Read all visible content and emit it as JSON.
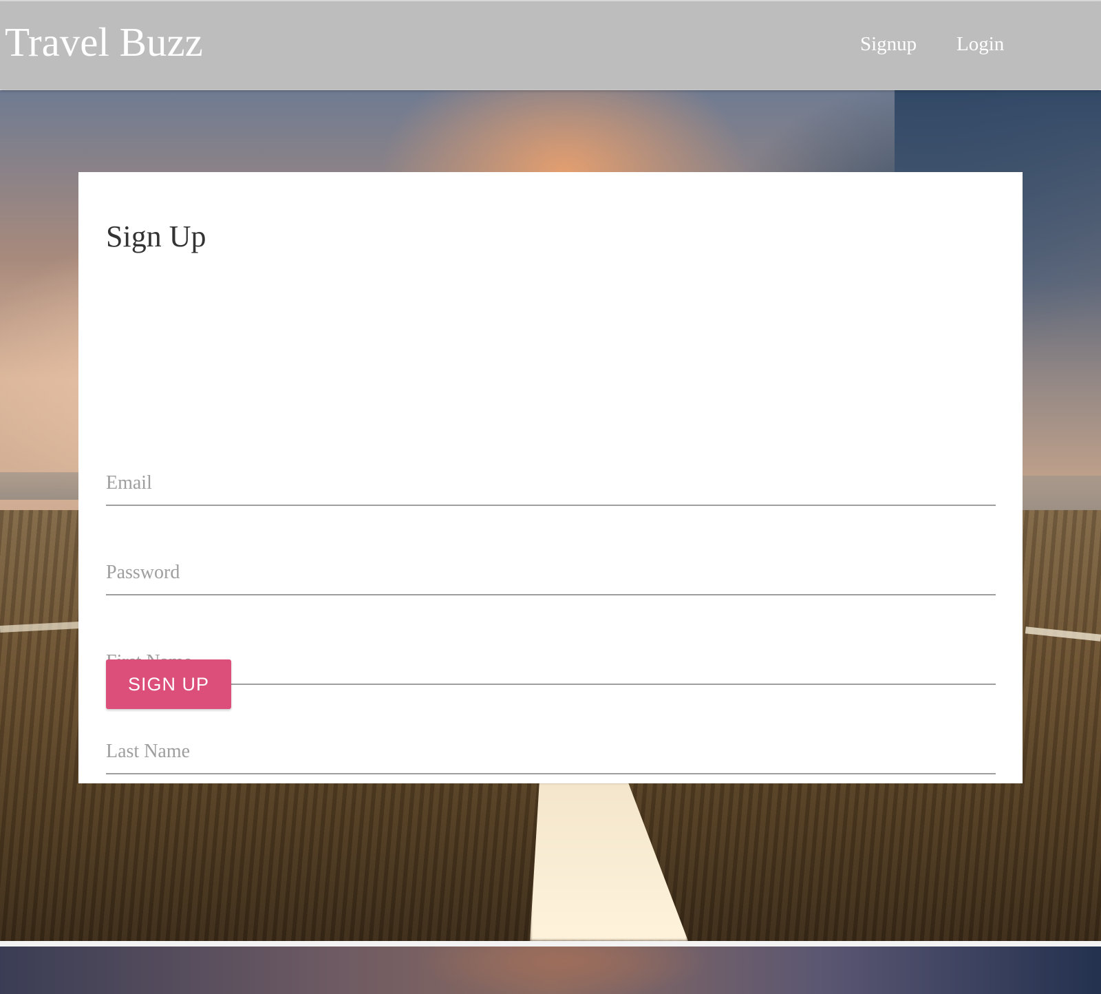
{
  "navbar": {
    "brand": "Travel Buzz",
    "links": [
      {
        "label": "Signup"
      },
      {
        "label": "Login"
      }
    ]
  },
  "signup_form": {
    "title": "Sign Up",
    "fields": {
      "email": {
        "placeholder": "Email",
        "value": ""
      },
      "password": {
        "placeholder": "Password",
        "value": ""
      },
      "first_name": {
        "placeholder": "First Name",
        "value": ""
      },
      "last_name": {
        "placeholder": "Last Name",
        "value": ""
      }
    },
    "submit_label": "Sign Up"
  },
  "colors": {
    "navbar_bg": "#bdbdbd",
    "button_bg": "#dc4f7b",
    "card_bg": "#ffffff",
    "input_underline": "#9e9e9e"
  }
}
